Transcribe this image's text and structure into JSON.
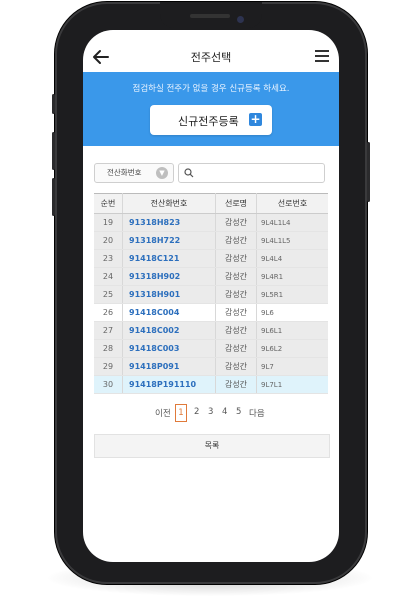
{
  "header": {
    "title": "전주선택"
  },
  "banner": {
    "message": "점검하실 전주가 없을 경우 신규등록 하세요.",
    "register_label": "신규전주등록"
  },
  "search": {
    "select_value": "전산화번호",
    "input_value": ""
  },
  "table": {
    "columns": [
      "순번",
      "전산화번호",
      "선로명",
      "선로번호"
    ],
    "rows": [
      [
        "19",
        "91318H823",
        "감성간",
        "9L4L1L4"
      ],
      [
        "20",
        "91318H722",
        "감성간",
        "9L4L1L5"
      ],
      [
        "23",
        "91418C121",
        "감성간",
        "9L4L4"
      ],
      [
        "24",
        "91318H902",
        "감성간",
        "9L4R1"
      ],
      [
        "25",
        "91318H901",
        "감성간",
        "9L5R1"
      ],
      [
        "26",
        "91418C004",
        "감성간",
        "9L6"
      ],
      [
        "27",
        "91418C002",
        "감성간",
        "9L6L1"
      ],
      [
        "28",
        "91418C003",
        "감성간",
        "9L6L2"
      ],
      [
        "29",
        "91418P091",
        "감성간",
        "9L7"
      ],
      [
        "30",
        "91418P191110",
        "감성간",
        "9L7L1"
      ]
    ]
  },
  "pagination": {
    "prev_label": "이전",
    "pages": [
      "1",
      "2",
      "3",
      "4",
      "5"
    ],
    "current": "1",
    "next_label": "다음"
  },
  "footer": {
    "list_label": "목록"
  },
  "colors": {
    "banner": "#3a98ea",
    "link": "#2c6fbd",
    "current_page": "#e07a3a",
    "highlight_row": "#dff3fb"
  }
}
